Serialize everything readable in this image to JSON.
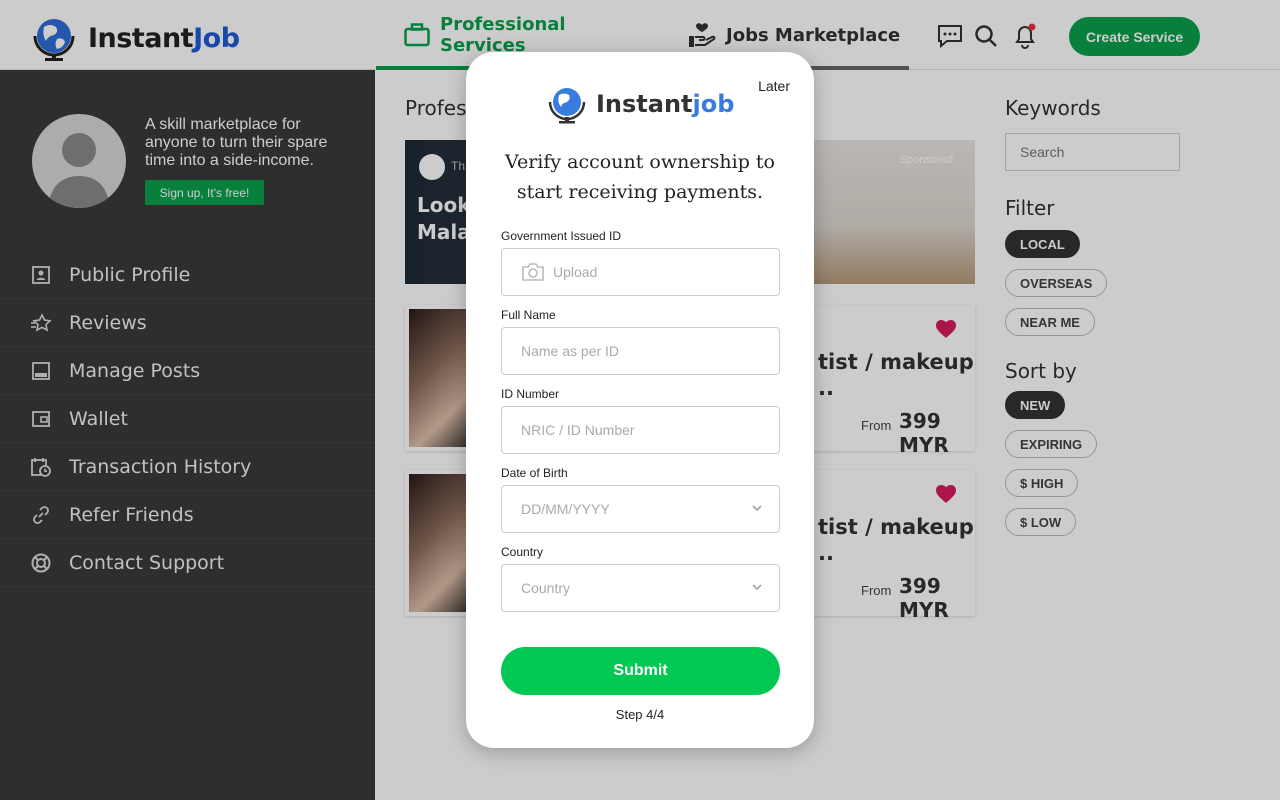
{
  "brand": {
    "part1": "Instant",
    "part2": "Job"
  },
  "nav": {
    "tab_pro": "Professional Services",
    "tab_jobs": "Jobs Marketplace",
    "create_button": "Create Service"
  },
  "sidebar": {
    "promo": "A skill marketplace for anyone to turn their spare time into a side-income.",
    "signup": "Sign up, It's free!",
    "items": [
      {
        "label": "Public Profile",
        "icon": "profile-card-icon"
      },
      {
        "label": "Reviews",
        "icon": "star-icon"
      },
      {
        "label": "Manage Posts",
        "icon": "posts-icon"
      },
      {
        "label": "Wallet",
        "icon": "wallet-icon"
      },
      {
        "label": "Transaction History",
        "icon": "history-icon"
      },
      {
        "label": "Refer Friends",
        "icon": "link-icon"
      },
      {
        "label": "Contact Support",
        "icon": "lifebuoy-icon"
      }
    ]
  },
  "main": {
    "section_title": "Profes",
    "banner": {
      "brand": "Th",
      "line1": "Look",
      "line2": "Mala",
      "sponsored": "Sponsored"
    },
    "cards": [
      {
        "title_line1": "tist / makeup",
        "title_line2": "..",
        "from": "From",
        "price": "399 MYR"
      },
      {
        "title_line1": "tist / makeup",
        "title_line2": "..",
        "from": "From",
        "price": "399 MYR"
      }
    ]
  },
  "right": {
    "keywords": "Keywords",
    "search_placeholder": "Search",
    "filter": "Filter",
    "filter_options": [
      "LOCAL",
      "OVERSEAS",
      "NEAR ME"
    ],
    "sort_by": "Sort by",
    "sort_options": [
      "NEW",
      "EXPIRING",
      "$ HIGH",
      "$ LOW"
    ]
  },
  "modal": {
    "later": "Later",
    "logo_part1": "Instant",
    "logo_part2": "job",
    "heading": "Verify account ownership to start receiving payments.",
    "fields": {
      "gov_id_label": "Government Issued ID",
      "gov_id_placeholder": "Upload",
      "full_name_label": "Full Name",
      "full_name_placeholder": "Name as per ID",
      "id_number_label": "ID Number",
      "id_number_placeholder": "NRIC / ID Number",
      "dob_label": "Date of Birth",
      "dob_placeholder": "DD/MM/YYYY",
      "country_label": "Country",
      "country_placeholder": "Country"
    },
    "submit": "Submit",
    "step": "Step 4/4"
  },
  "colors": {
    "brand_green": "#0aa14b",
    "submit_green": "#00c853",
    "brand_blue": "#1e5ad6",
    "heart": "#d81b60"
  }
}
